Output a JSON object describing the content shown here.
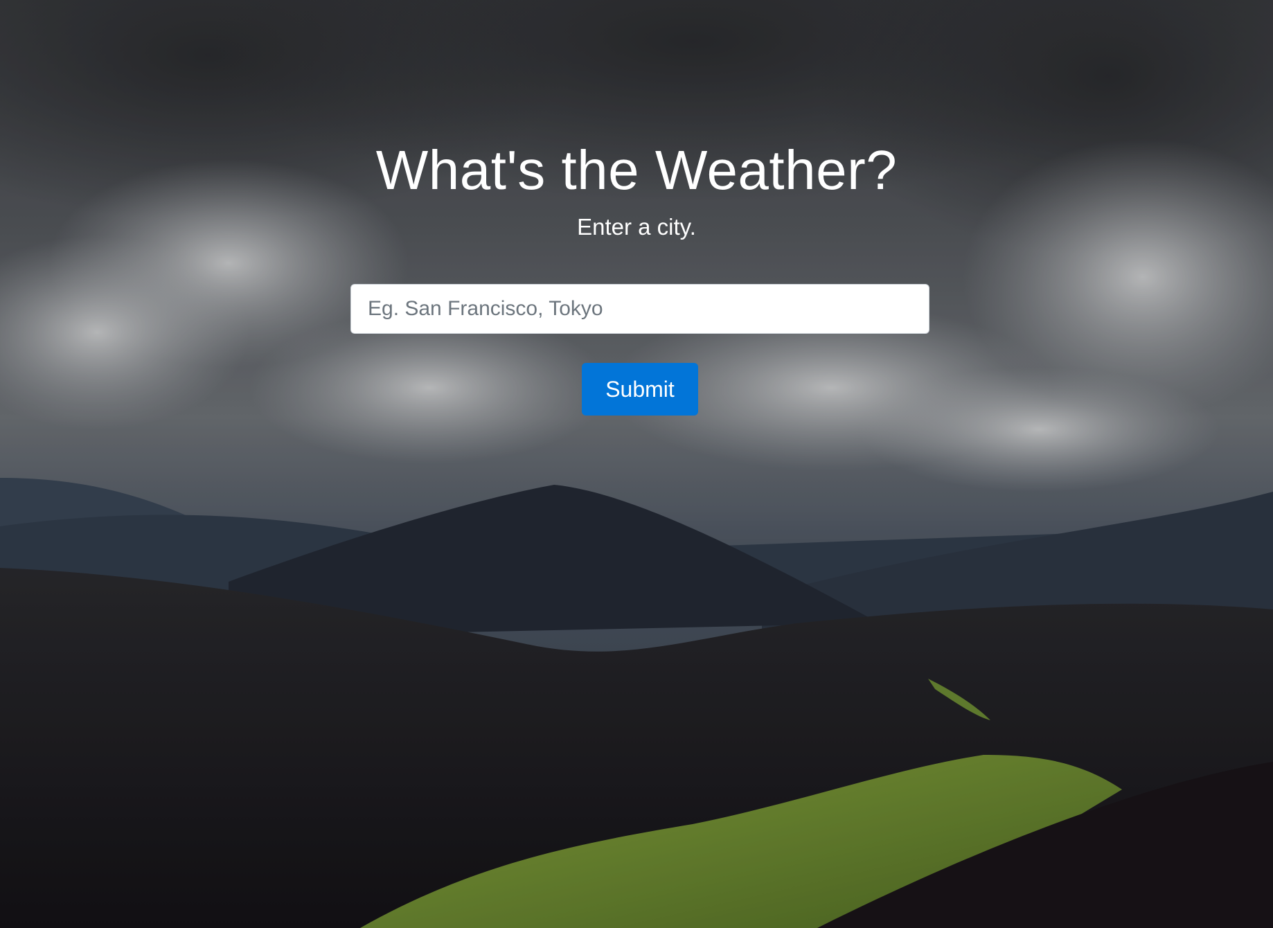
{
  "header": {
    "title": "What's the Weather?",
    "subtitle": "Enter a city."
  },
  "search": {
    "placeholder": "Eg. San Francisco, Tokyo",
    "value": ""
  },
  "form": {
    "submit_label": "Submit"
  },
  "colors": {
    "accent": "#0275d8",
    "text": "#ffffff"
  }
}
